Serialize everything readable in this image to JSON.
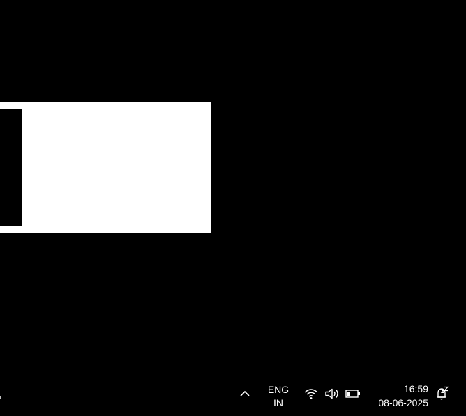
{
  "taskbar": {
    "language": {
      "line1": "ENG",
      "line2": "IN"
    },
    "clock": {
      "time": "16:59",
      "date": "08-06-2025"
    },
    "icons": {
      "show_hidden": "chevron-up-icon",
      "network": "wifi-icon",
      "volume": "speaker-icon",
      "battery": "battery-icon",
      "notifications": "notification-bell-icon"
    }
  },
  "colors": {
    "desktop_background": "#000000",
    "window_background": "#ffffff",
    "taskbar_foreground": "#ffffff"
  }
}
